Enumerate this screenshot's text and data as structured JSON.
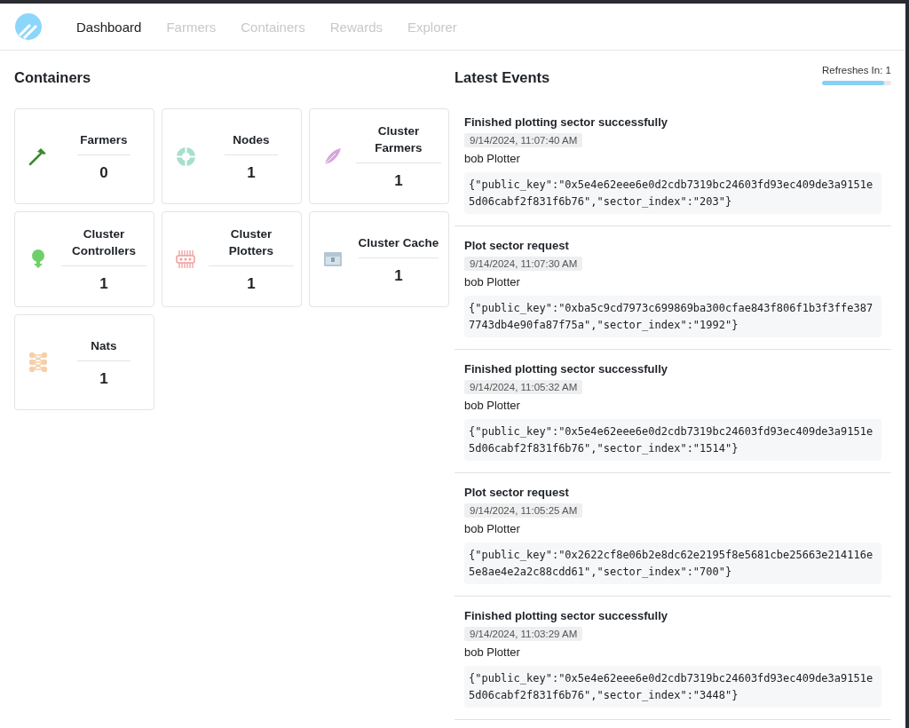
{
  "nav": {
    "items": [
      {
        "label": "Dashboard",
        "selected": true
      },
      {
        "label": "Farmers",
        "selected": false
      },
      {
        "label": "Containers",
        "selected": false
      },
      {
        "label": "Rewards",
        "selected": false
      },
      {
        "label": "Explorer",
        "selected": false
      }
    ]
  },
  "containers": {
    "title": "Containers",
    "cards": [
      {
        "kind": "hammer",
        "label": "Farmers",
        "count": "0"
      },
      {
        "kind": "crosshair",
        "label": "Nodes",
        "count": "1"
      },
      {
        "kind": "feather",
        "label": "Cluster Farmers",
        "count": "1"
      },
      {
        "kind": "tree",
        "label": "Cluster Controllers",
        "count": "1"
      },
      {
        "kind": "chip",
        "label": "Cluster Plotters",
        "count": "1"
      },
      {
        "kind": "chest",
        "label": "Cluster Cache",
        "count": "1"
      },
      {
        "kind": "network",
        "label": "Nats",
        "count": "1"
      }
    ]
  },
  "events": {
    "title": "Latest Events",
    "refresh": {
      "label": "Refreshes In: 1",
      "level": 0.9
    },
    "items": [
      {
        "title": "Finished plotting sector successfully",
        "time": "9/14/2024, 11:07:40 AM",
        "source": "bob Plotter",
        "payload": "{\"public_key\":\"0x5e4e62eee6e0d2cdb7319bc24603fd93ec409de3a9151e5d06cabf2f831f6b76\",\"sector_index\":\"203\"}"
      },
      {
        "title": "Plot sector request",
        "time": "9/14/2024, 11:07:30 AM",
        "source": "bob Plotter",
        "payload": "{\"public_key\":\"0xba5c9cd7973c699869ba300cfae843f806f1b3f3ffe3877743db4e90fa87f75a\",\"sector_index\":\"1992\"}"
      },
      {
        "title": "Finished plotting sector successfully",
        "time": "9/14/2024, 11:05:32 AM",
        "source": "bob Plotter",
        "payload": "{\"public_key\":\"0x5e4e62eee6e0d2cdb7319bc24603fd93ec409de3a9151e5d06cabf2f831f6b76\",\"sector_index\":\"1514\"}"
      },
      {
        "title": "Plot sector request",
        "time": "9/14/2024, 11:05:25 AM",
        "source": "bob Plotter",
        "payload": "{\"public_key\":\"0x2622cf8e06b2e8dc62e2195f8e5681cbe25663e214116e5e8ae4e2a2c88cdd61\",\"sector_index\":\"700\"}"
      },
      {
        "title": "Finished plotting sector successfully",
        "time": "9/14/2024, 11:03:29 AM",
        "source": "bob Plotter",
        "payload": "{\"public_key\":\"0x5e4e62eee6e0d2cdb7319bc24603fd93ec409de3a9151e5d06cabf2f831f6b76\",\"sector_index\":\"3448\"}"
      }
    ]
  }
}
